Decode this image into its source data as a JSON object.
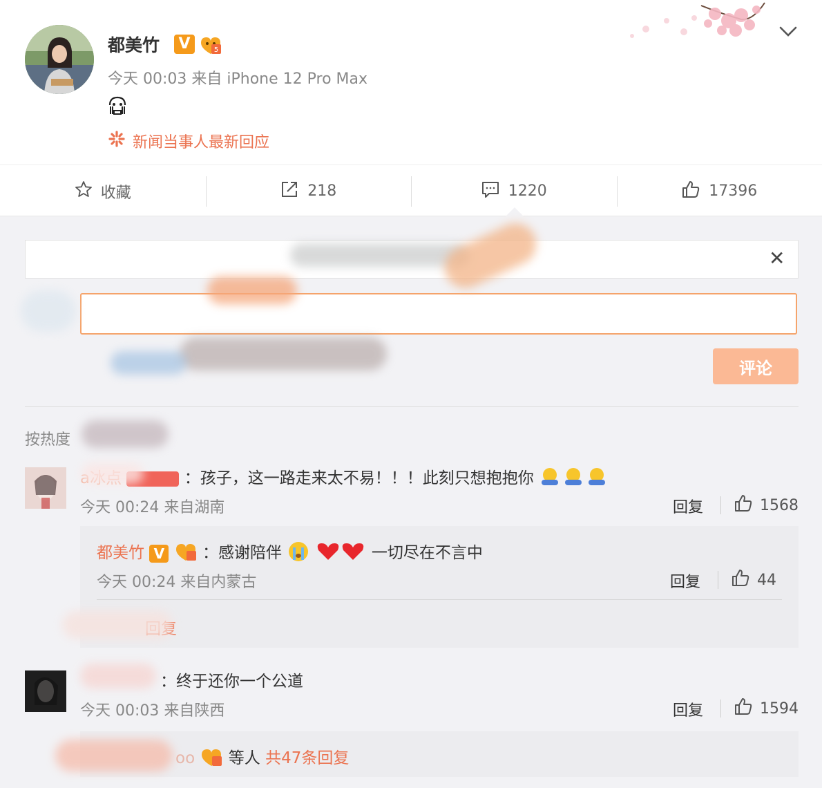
{
  "post": {
    "author": "都美竹",
    "verified_mark": "V",
    "timestamp": "今天 00:03",
    "source": "来自 iPhone 12 Pro Max",
    "body_emoji": "crying-face",
    "topic_label": "新闻当事人最新回应",
    "colors": {
      "accent": "#eb7350",
      "vip": "#f59a1a"
    }
  },
  "actions": {
    "favorite_label": "收藏",
    "share_count": "218",
    "comment_count": "1220",
    "like_count": "17396"
  },
  "composer": {
    "submit_label": "评论"
  },
  "sort_label": "按热度",
  "comments": [
    {
      "author_visible": "a冰点",
      "text": "：孩子，这一路走来太不易！！！此刻只想抱抱你",
      "meta": "今天 00:24 来自湖南",
      "reply_label": "回复",
      "likes": "1568",
      "reply": {
        "author": "都美竹",
        "verified_mark": "V",
        "text": "：感谢陪伴",
        "text_after": "一切尽在不言中",
        "meta": "今天 00:24 来自内蒙古",
        "reply_label": "回复",
        "likes": "44",
        "more_label": "回复"
      }
    },
    {
      "text": "：终于还你一个公道",
      "meta": "今天 00:03 来自陕西",
      "reply_label": "回复",
      "likes": "1594",
      "more_partial": "oo",
      "more_mid": "等人",
      "more_link": "共47条回复"
    }
  ]
}
